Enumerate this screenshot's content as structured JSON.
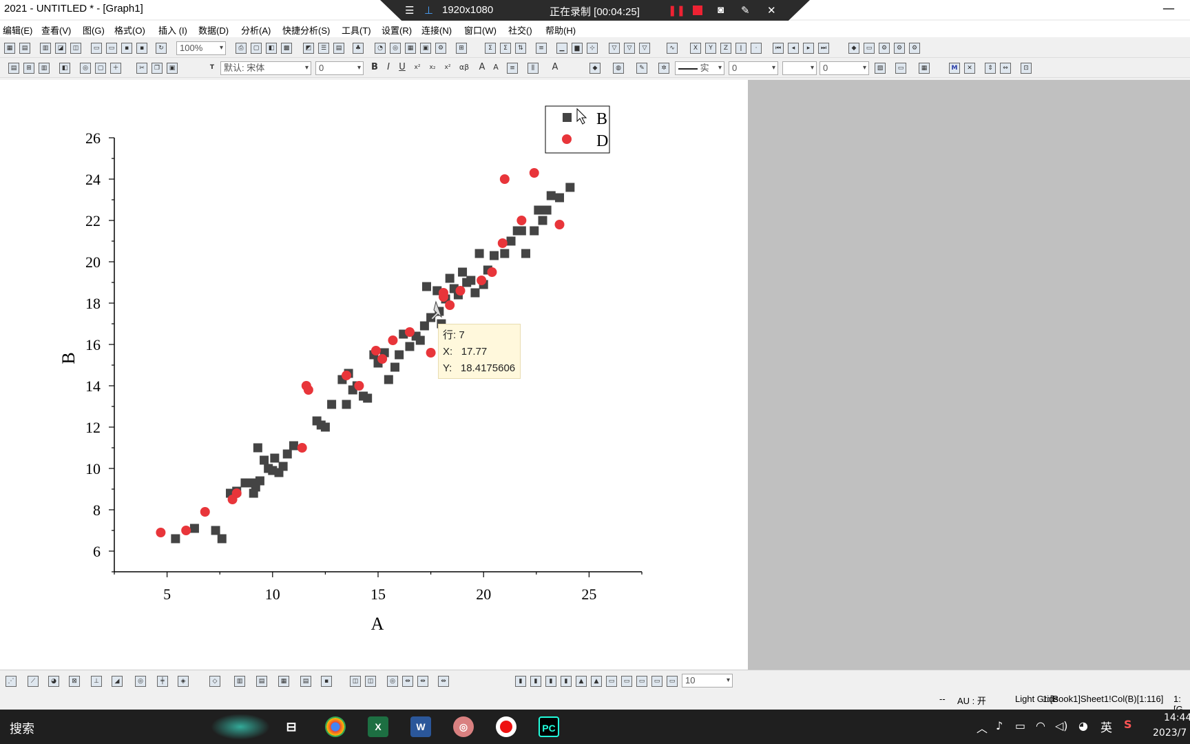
{
  "app": {
    "title": "2021 - UNTITLED * - [Graph1]",
    "minimize_label": "—"
  },
  "recorder": {
    "resolution": "1920x1080",
    "status": "正在录制 [00:04:25]"
  },
  "menu": [
    "编辑(E)",
    "查看(V)",
    "图(G)",
    "格式(O)",
    "插入 (I)",
    "数据(D)",
    "分析(A)",
    "快捷分析(S)",
    "工具(T)",
    "设置(R)",
    "连接(N)",
    "窗口(W)",
    "社交()",
    "帮助(H)"
  ],
  "toolbar": {
    "zoom": "100%",
    "font": "默认: 宋体",
    "font_size": "0",
    "line_width": "0",
    "pattern_value": "0",
    "line_style": "实",
    "bottom_size": "10"
  },
  "chart_data": {
    "type": "scatter",
    "xlabel": "A",
    "ylabel": "B",
    "xlim": [
      2.5,
      27.5
    ],
    "ylim": [
      5,
      26
    ],
    "xticks": [
      5,
      10,
      15,
      20,
      25
    ],
    "yticks": [
      6,
      8,
      10,
      12,
      14,
      16,
      18,
      20,
      22,
      24,
      26
    ],
    "legend_position": "top-right",
    "series": [
      {
        "name": "B",
        "marker": "square",
        "color": "#444444",
        "x": [
          5.4,
          6.3,
          7.3,
          7.6,
          8.0,
          8.3,
          8.7,
          9.0,
          9.1,
          9.2,
          9.3,
          9.4,
          9.6,
          9.8,
          10.0,
          10.1,
          10.3,
          10.5,
          10.7,
          11.0,
          12.1,
          12.3,
          12.5,
          12.8,
          13.3,
          13.5,
          13.6,
          13.8,
          14.0,
          14.3,
          14.5,
          14.8,
          15.0,
          15.3,
          15.5,
          15.8,
          16.0,
          16.2,
          16.5,
          16.8,
          17.0,
          17.2,
          17.3,
          17.5,
          17.8,
          17.9,
          18.0,
          18.2,
          18.4,
          18.6,
          18.8,
          19.0,
          19.2,
          19.4,
          19.6,
          19.8,
          20.0,
          20.2,
          20.5,
          21.0,
          21.3,
          21.6,
          21.8,
          22.0,
          22.4,
          22.6,
          22.8,
          23.0,
          23.2,
          23.6,
          24.1
        ],
        "y": [
          6.6,
          7.1,
          7.0,
          6.6,
          8.8,
          8.9,
          9.3,
          9.3,
          8.8,
          9.1,
          11.0,
          9.4,
          10.4,
          10.0,
          9.9,
          10.5,
          9.8,
          10.1,
          10.7,
          11.1,
          12.3,
          12.1,
          12.0,
          13.1,
          14.3,
          13.1,
          14.6,
          13.8,
          14.0,
          13.5,
          13.4,
          15.5,
          15.1,
          15.6,
          14.3,
          14.9,
          15.5,
          16.5,
          15.9,
          16.4,
          16.2,
          16.9,
          18.8,
          17.3,
          18.6,
          17.6,
          17.0,
          18.2,
          19.2,
          18.7,
          18.4,
          19.5,
          19.0,
          19.1,
          18.5,
          20.4,
          18.9,
          19.6,
          20.3,
          20.4,
          21.0,
          21.5,
          21.5,
          20.4,
          21.5,
          22.5,
          22.0,
          22.5,
          23.2,
          23.1,
          23.6
        ]
      },
      {
        "name": "D",
        "marker": "circle",
        "color": "#e8353a",
        "x": [
          4.7,
          5.9,
          6.8,
          8.1,
          8.3,
          11.4,
          11.6,
          11.7,
          13.5,
          14.1,
          14.9,
          15.2,
          15.7,
          16.5,
          17.5,
          18.1,
          18.1,
          18.4,
          18.9,
          19.9,
          20.4,
          20.9,
          21.0,
          21.8,
          22.4,
          23.6
        ],
        "y": [
          6.9,
          7.0,
          7.9,
          8.5,
          8.8,
          11.0,
          14.0,
          13.8,
          14.5,
          14.0,
          15.7,
          15.3,
          16.2,
          16.6,
          15.6,
          18.5,
          18.3,
          17.9,
          18.6,
          19.1,
          19.5,
          20.9,
          24.0,
          22.0,
          24.3,
          21.8
        ]
      }
    ]
  },
  "tooltip": {
    "row_label": "行:",
    "row_value": "7",
    "x_label": "X:",
    "x_value": "17.77",
    "y_label": "Y:",
    "y_value": "18.4175606"
  },
  "status": {
    "dashes": "--",
    "au": "AU : 开",
    "grids": "Light Grids",
    "sheet": "1:[Book1]Sheet1!Col(B)[1:116]",
    "tail": "1:[G"
  },
  "taskbar": {
    "search": "搜索",
    "ime": "英",
    "time": "14:44",
    "date": "2023/7"
  }
}
